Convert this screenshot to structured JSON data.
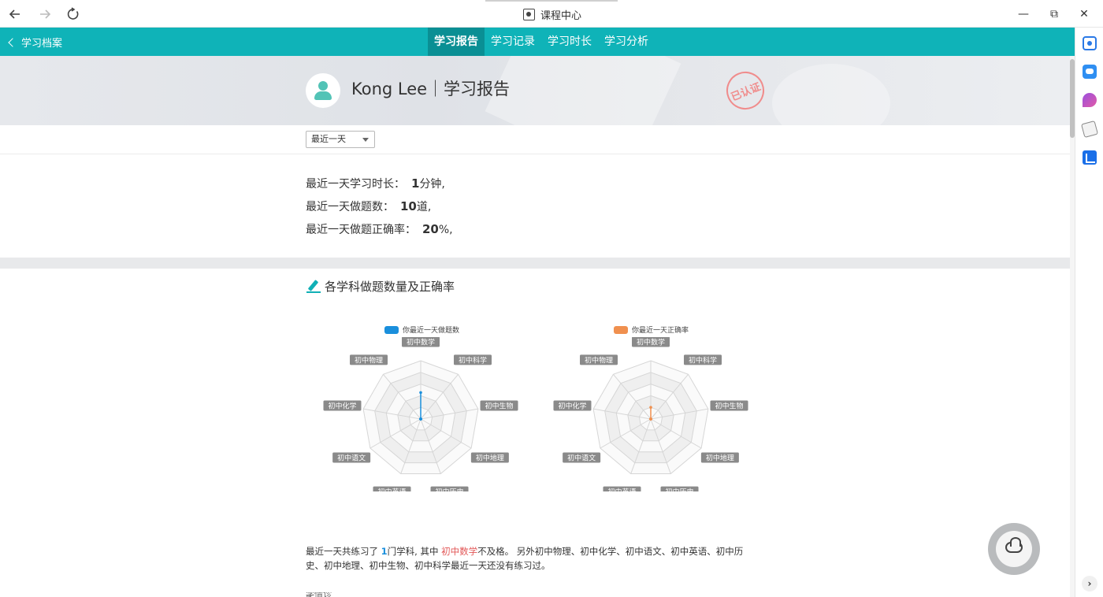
{
  "window": {
    "title": "课程中心",
    "back_icon": "arrow-left-icon",
    "forward_icon": "arrow-right-icon",
    "refresh_icon": "refresh-icon",
    "minimize": "—",
    "restore": "⧉",
    "close": "✕"
  },
  "topnav": {
    "back_label": "学习档案",
    "tabs": [
      {
        "label": "学习报告",
        "active": true
      },
      {
        "label": "学习记录",
        "active": false
      },
      {
        "label": "学习时长",
        "active": false
      },
      {
        "label": "学习分析",
        "active": false
      }
    ],
    "accent": "#0fb3b8"
  },
  "banner": {
    "name": "Kong Lee｜学习报告",
    "seal": "已认证"
  },
  "filter": {
    "selected": "最近一天"
  },
  "stats": {
    "duration_label": "最近一天学习时长：",
    "duration_value": "1",
    "duration_unit": "分钟,",
    "questions_label": "最近一天做题数：",
    "questions_value": "10",
    "questions_unit": "道,",
    "accuracy_label": "最近一天做题正确率：",
    "accuracy_value": "20",
    "accuracy_unit": "%,"
  },
  "section": {
    "title": "各学科做题数量及正确率"
  },
  "chart_data": [
    {
      "type": "radar",
      "legend": "你最近一天做题数",
      "color": "#1a8fdc",
      "axes": [
        "初中数学",
        "初中科学",
        "初中生物",
        "初中地理",
        "初中历史",
        "初中英语",
        "初中语文",
        "初中化学",
        "初中物理"
      ],
      "values": [
        10,
        0,
        0,
        0,
        0,
        0,
        0,
        0,
        0
      ],
      "max": 22
    },
    {
      "type": "radar",
      "legend": "你最近一天正确率",
      "color": "#f0904f",
      "axes": [
        "初中数学",
        "初中科学",
        "初中生物",
        "初中地理",
        "初中历史",
        "初中英语",
        "初中语文",
        "初中化学",
        "初中物理"
      ],
      "values": [
        20,
        0,
        0,
        0,
        0,
        0,
        0,
        0,
        0
      ],
      "max": 100
    }
  ],
  "summary": {
    "p1": "最近一天共练习了 ",
    "count": "1",
    "p2": "门学科, 其中 ",
    "failed": "初中数学",
    "p3": "不及格。 另外初中物理、初中化学、初中语文、初中英语、初中历史、初中地理、初中生物、初中科学最近一天还没有练习过。"
  },
  "hint": "学情诊断"
}
